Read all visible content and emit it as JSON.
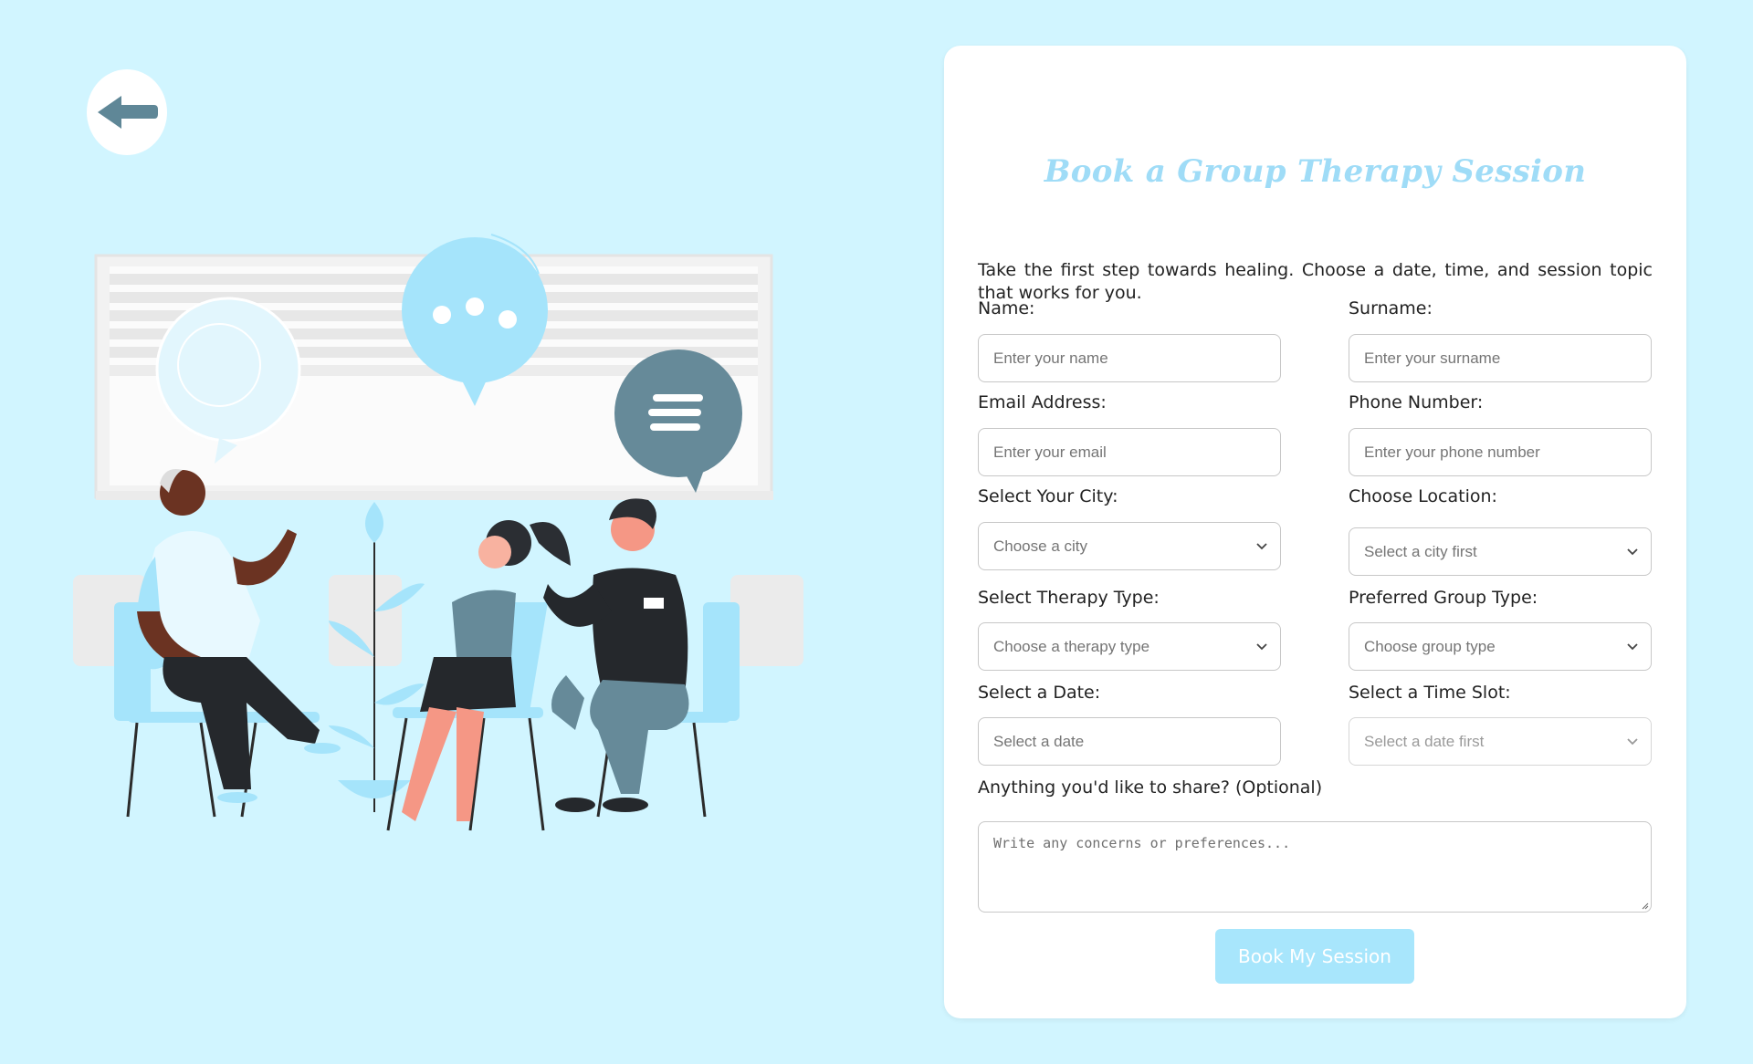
{
  "form": {
    "title": "Book a Group Therapy Session",
    "intro": "Take the first step towards healing. Choose a date, time, and session topic that works for you.",
    "name_label": "Name:",
    "name_placeholder": "Enter your name",
    "surname_label": "Surname:",
    "surname_placeholder": "Enter your surname",
    "email_label": "Email Address:",
    "email_placeholder": "Enter your email",
    "phone_label": "Phone Number:",
    "phone_placeholder": "Enter your phone number",
    "city_label": "Select Your City:",
    "city_value": "Choose a city",
    "location_label": "Choose Location:",
    "location_value": "Select a city first",
    "therapy_label": "Select Therapy Type:",
    "therapy_value": "Choose a therapy type",
    "group_label": "Preferred Group Type:",
    "group_value": "Choose group type",
    "date_label": "Select a Date:",
    "date_placeholder": "Select a date",
    "time_label": "Select a Time Slot:",
    "time_value": "Select a date first",
    "share_label": "Anything you'd like to share? (Optional)",
    "share_placeholder": "Write any concerns or preferences...",
    "submit_label": "Book My Session"
  },
  "icons": {
    "back": "back-arrow-icon",
    "chevron": "chevron-down-icon"
  },
  "colors": {
    "page_background": "#d1f5ff",
    "title": "#9fdcf7",
    "button": "#a8e6fc",
    "back_arrow": "#5f8797",
    "speech_dark": "#668a99"
  }
}
